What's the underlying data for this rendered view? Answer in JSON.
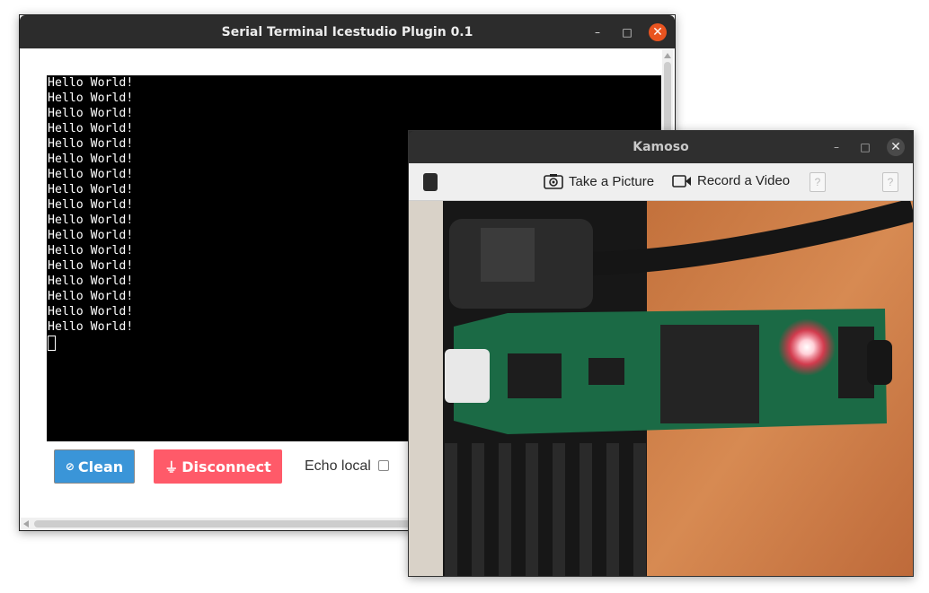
{
  "serial_window": {
    "title": "Serial Terminal Icestudio Plugin 0.1",
    "terminal_lines": [
      "Hello World!",
      "Hello World!",
      "Hello World!",
      "Hello World!",
      "Hello World!",
      "Hello World!",
      "Hello World!",
      "Hello World!",
      "Hello World!",
      "Hello World!",
      "Hello World!",
      "Hello World!",
      "Hello World!",
      "Hello World!",
      "Hello World!",
      "Hello World!",
      "Hello World!"
    ],
    "clean_label": "Clean",
    "disconnect_label": "Disconnect",
    "echo_label": "Echo local",
    "echo_checked": false,
    "colors": {
      "clean": "#3a95d8",
      "disconnect": "#ff5a69",
      "close": "#e95420"
    }
  },
  "kamoso_window": {
    "title": "Kamoso",
    "take_picture_label": "Take a Picture",
    "record_video_label": "Record a Video",
    "help_glyph": "?",
    "preview_description_icon": "camera-preview"
  },
  "window_controls": {
    "minimize": "–",
    "maximize": "□",
    "close": "✕"
  }
}
